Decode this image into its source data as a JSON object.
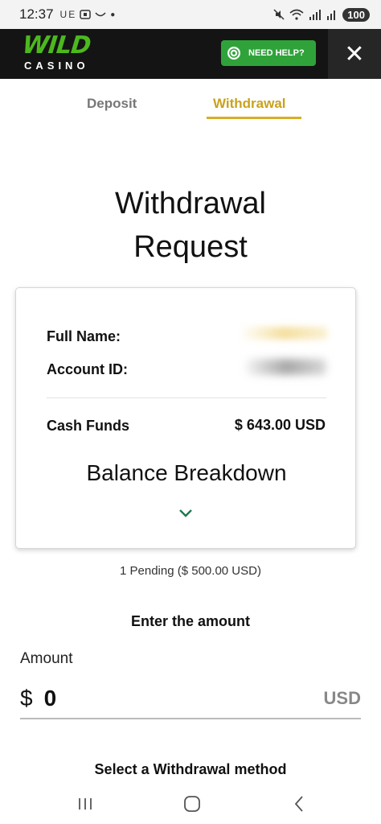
{
  "status_bar": {
    "time": "12:37",
    "left_icons": "UE",
    "battery": "100"
  },
  "header": {
    "logo_top": "WILD",
    "logo_bottom": "CASINO",
    "help_label": "NEED HELP?",
    "close_label": "✕"
  },
  "tabs": [
    {
      "label": "Deposit",
      "active": false
    },
    {
      "label": "Withdrawal",
      "active": true
    }
  ],
  "page": {
    "title_line1": "Withdrawal",
    "title_line2": "Request"
  },
  "card": {
    "full_name_label": "Full Name:",
    "account_id_label": "Account ID:",
    "cash_funds_label": "Cash Funds",
    "cash_funds_value": "$ 643.00 USD",
    "breakdown_label": "Balance Breakdown"
  },
  "pending_text": "1 Pending ($ 500.00 USD)",
  "amount_section": {
    "heading": "Enter the amount",
    "label": "Amount",
    "currency_symbol": "$",
    "value": "0",
    "currency_code": "USD"
  },
  "method_heading": "Select a Withdrawal method",
  "colors": {
    "brand_green": "#4cb81e",
    "help_green": "#2fa33a",
    "active_tab": "#c9a21d",
    "chevron": "#1e7a4f"
  }
}
